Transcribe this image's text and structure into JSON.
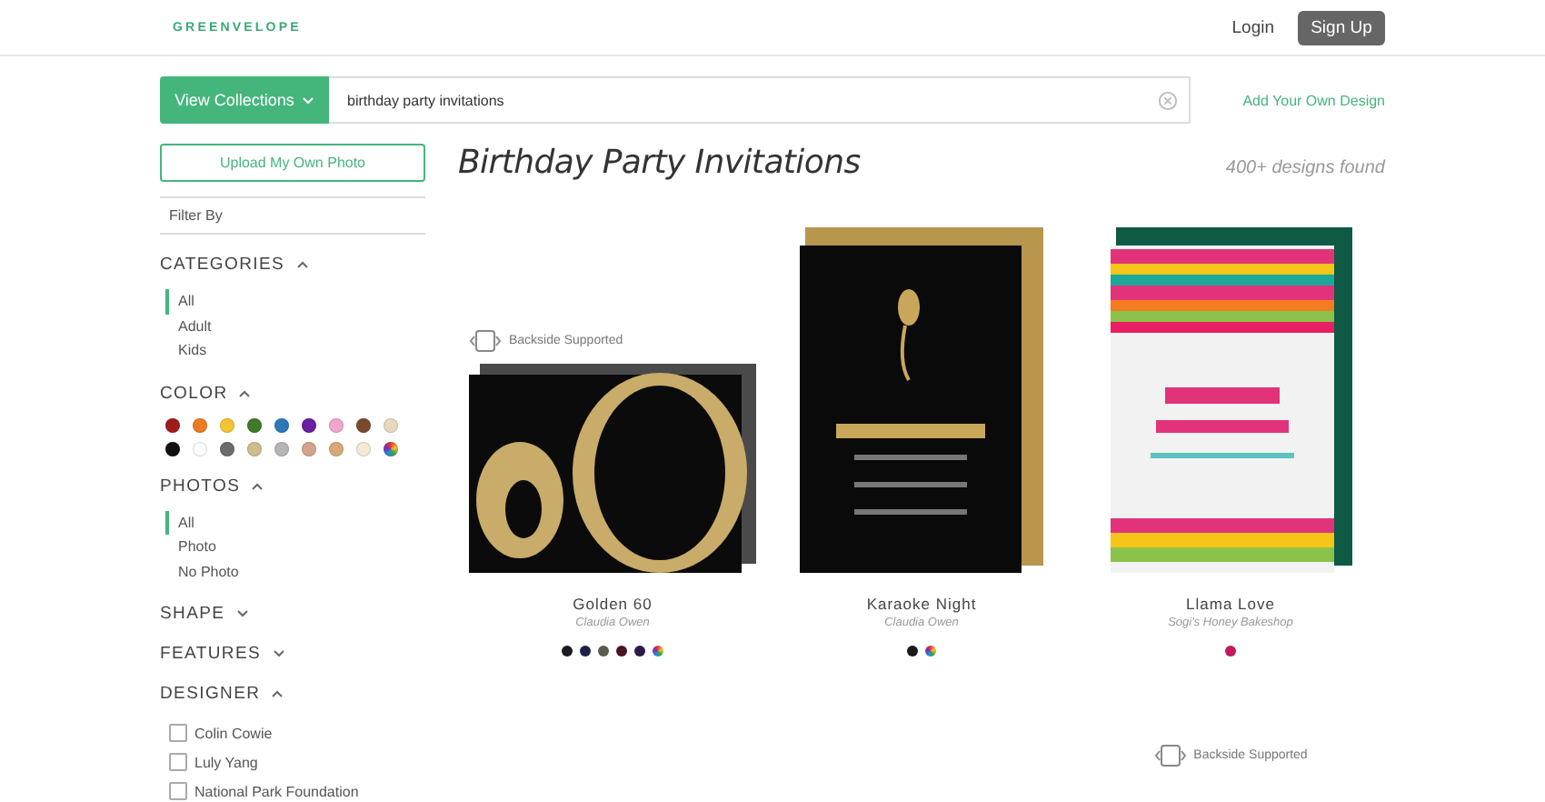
{
  "header": {
    "logo": "GREENVELOPE",
    "login": "Login",
    "signup": "Sign Up"
  },
  "search": {
    "collections_button": "View Collections",
    "value": "birthday party invitations",
    "add_link": "Add Your Own Design"
  },
  "sidebar": {
    "upload_button": "Upload My Own Photo",
    "filter_by": "Filter By",
    "sections": [
      {
        "kind": "list",
        "title": "CATEGORIES",
        "expanded": true,
        "items": [
          {
            "label": "All",
            "selected": true
          },
          {
            "label": "Adult",
            "selected": false
          },
          {
            "label": "Kids",
            "selected": false
          }
        ]
      },
      {
        "kind": "swatches",
        "title": "COLOR",
        "expanded": true,
        "swatches": [
          {
            "color": "#a01c1c"
          },
          {
            "color": "#ee7a22"
          },
          {
            "color": "#f3c530"
          },
          {
            "color": "#3e7a28"
          },
          {
            "color": "#2f78b8"
          },
          {
            "color": "#6a1fa0"
          },
          {
            "color": "#f1a6cf"
          },
          {
            "color": "#7a4a2e"
          },
          {
            "color": "#e6d9bd"
          },
          {
            "color": "#111111"
          },
          {
            "color": "#ffffff"
          },
          {
            "color": "#6b6b6b"
          },
          {
            "color": "#cdbd8c"
          },
          {
            "color": "#b5b5b5"
          },
          {
            "color": "#d2a48c"
          },
          {
            "color": "#d9a878"
          },
          {
            "color": "#f3ead6"
          },
          {
            "kind": "multi"
          }
        ]
      },
      {
        "kind": "list",
        "title": "PHOTOS",
        "expanded": true,
        "items": [
          {
            "label": "All",
            "selected": true
          },
          {
            "label": "Photo",
            "selected": false
          },
          {
            "label": "No Photo",
            "selected": false
          }
        ]
      },
      {
        "title": "SHAPE",
        "expanded": false
      },
      {
        "title": "FEATURES",
        "expanded": false
      },
      {
        "kind": "checks",
        "title": "DESIGNER",
        "expanded": true,
        "items": [
          {
            "label": "Colin Cowie",
            "checked": false
          },
          {
            "label": "Luly Yang",
            "checked": false
          },
          {
            "label": "National Park Foundation",
            "checked": false
          }
        ]
      }
    ]
  },
  "main": {
    "title": "Birthday Party Invitations",
    "count": "400+ designs found",
    "cards": [
      {
        "kind": "golden",
        "backside": "Backside Supported",
        "name": "Golden 60",
        "designer": "Claudia Owen",
        "dots": [
          {
            "color": "#1b1b24"
          },
          {
            "color": "#1c1f4a"
          },
          {
            "color": "#5d5a4e"
          },
          {
            "color": "#4a1420"
          },
          {
            "color": "#2b1a4a"
          },
          {
            "kind": "multi"
          }
        ]
      },
      {
        "kind": "karaoke",
        "name": "Karaoke Night",
        "designer": "Claudia Owen",
        "dots": [
          {
            "color": "#1a1a1a"
          },
          {
            "kind": "multi"
          }
        ]
      },
      {
        "kind": "stripes",
        "name": "Llama Love",
        "designer": "Sogi's Honey Bakeshop",
        "dots": [
          {
            "color": "#c4195c"
          }
        ]
      },
      {
        "kind": "partial",
        "backside": "Backside Supported"
      }
    ]
  }
}
